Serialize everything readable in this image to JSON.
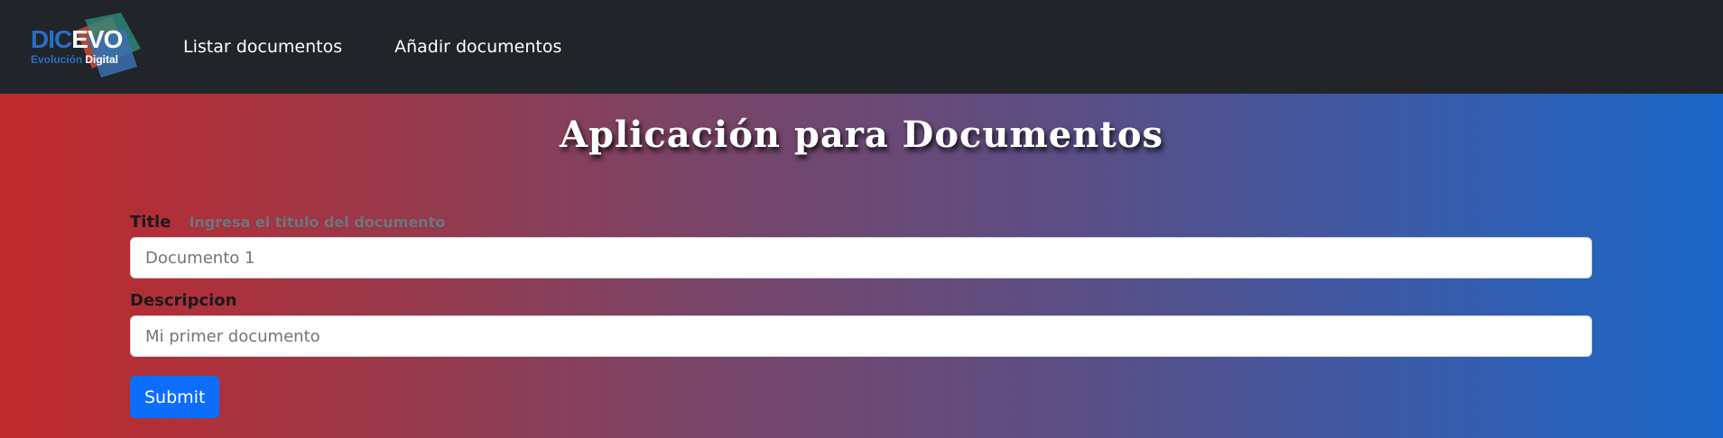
{
  "brand": {
    "logo_main_part1": "DIC",
    "logo_main_part2": "EVO",
    "logo_sub_part1": "Evolución",
    "logo_sub_part2": "Digital"
  },
  "nav": {
    "items": [
      {
        "label": "Listar documentos"
      },
      {
        "label": "Añadir documentos"
      }
    ]
  },
  "hero": {
    "title": "Aplicación para Documentos"
  },
  "form": {
    "title_label": "Title",
    "title_help": "Ingresa el titulo del documento",
    "title_placeholder": "Documento 1",
    "description_label": "Descripcion",
    "description_placeholder": "Mi primer documento",
    "submit_label": "Submit"
  },
  "colors": {
    "navbar_bg": "#212529",
    "gradient_start": "#c0292b",
    "gradient_end": "#1a67c8",
    "primary_button": "#0d6efd"
  }
}
